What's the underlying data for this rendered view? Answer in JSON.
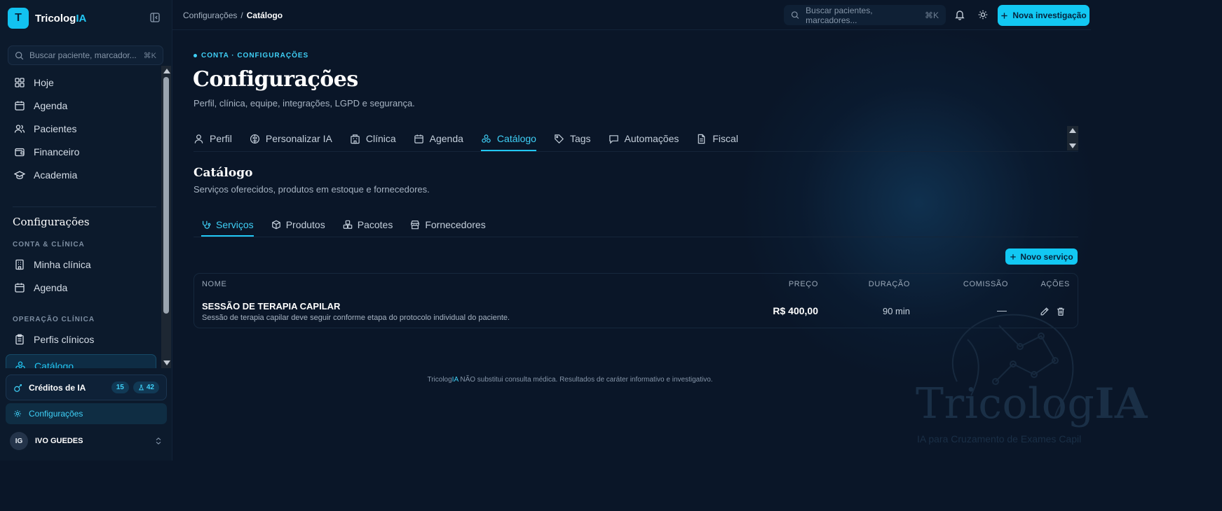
{
  "app": {
    "name_prefix": "Tricolog",
    "name_accent": "IA",
    "logo_letter": "T",
    "accent_color": "#12c8f3",
    "background_color": "#0a1628"
  },
  "sidebar": {
    "search_placeholder": "Buscar paciente, marcador...",
    "search_kbd": "⌘K",
    "main_items": [
      {
        "label": "Hoje",
        "icon": "grid-icon"
      },
      {
        "label": "Agenda",
        "icon": "calendar-icon"
      },
      {
        "label": "Pacientes",
        "icon": "users-icon"
      },
      {
        "label": "Financeiro",
        "icon": "wallet-icon"
      },
      {
        "label": "Academia",
        "icon": "graduation-cap-icon"
      }
    ],
    "settings_heading": "Configurações",
    "group_account": "CONTA & CLÍNICA",
    "account_items": [
      {
        "label": "Minha clínica",
        "icon": "building-icon"
      },
      {
        "label": "Agenda",
        "icon": "calendar-icon"
      }
    ],
    "group_clinical": "OPERAÇÃO CLÍNICA",
    "clinical_items": [
      {
        "label": "Perfis clínicos",
        "icon": "clipboard-icon"
      },
      {
        "label": "Catálogo",
        "icon": "catalog-icon",
        "active": true
      }
    ],
    "credits": {
      "label": "Créditos de IA",
      "badge1": "15",
      "badge2": "42"
    },
    "settings_link": "Configurações",
    "user": {
      "initials": "IG",
      "name": "IVO GUEDES"
    }
  },
  "topbar": {
    "breadcrumb_parent": "Configurações",
    "breadcrumb_separator": "/",
    "breadcrumb_current": "Catálogo",
    "search_placeholder": "Buscar pacientes, marcadores...",
    "search_kbd": "⌘K",
    "new_button": "Nova investigação"
  },
  "page": {
    "eyebrow": "CONTA · CONFIGURAÇÕES",
    "title": "Configurações",
    "subtitle": "Perfil, clínica, equipe, integrações, LGPD e segurança.",
    "tabs": [
      {
        "label": "Perfil",
        "icon": "user-icon"
      },
      {
        "label": "Personalizar IA",
        "icon": "brain-icon"
      },
      {
        "label": "Clínica",
        "icon": "building-icon"
      },
      {
        "label": "Agenda",
        "icon": "calendar-icon"
      },
      {
        "label": "Catálogo",
        "icon": "catalog-icon",
        "active": true
      },
      {
        "label": "Tags",
        "icon": "tag-icon"
      },
      {
        "label": "Automações",
        "icon": "message-icon"
      },
      {
        "label": "Fiscal",
        "icon": "file-icon"
      }
    ]
  },
  "catalog": {
    "title": "Catálogo",
    "subtitle": "Serviços oferecidos, produtos em estoque e fornecedores.",
    "subtabs": [
      {
        "label": "Serviços",
        "icon": "stethoscope-icon",
        "active": true
      },
      {
        "label": "Produtos",
        "icon": "box-icon"
      },
      {
        "label": "Pacotes",
        "icon": "boxes-icon"
      },
      {
        "label": "Fornecedores",
        "icon": "store-icon"
      }
    ],
    "new_service_button": "Novo serviço",
    "columns": {
      "name": "NOME",
      "price": "PREÇO",
      "duration": "DURAÇÃO",
      "commission": "COMISSÃO",
      "actions": "AÇÕES"
    },
    "rows": [
      {
        "name": "SESSÃO DE TERAPIA CAPILAR",
        "description": "Sessão de terapia capilar deve seguir conforme etapa do protocolo individual do paciente.",
        "price": "R$ 400,00",
        "duration": "90 min",
        "commission": "—"
      }
    ]
  },
  "footer": {
    "brand_prefix": "Tricolog",
    "brand_accent": "IA",
    "text": " NÃO substitui consulta médica. Resultados de caráter informativo e investigativo."
  },
  "watermark": {
    "text_prefix": "Tricolog",
    "text_accent": "IA",
    "tagline": "IA para Cruzamento de Exames Capil"
  }
}
